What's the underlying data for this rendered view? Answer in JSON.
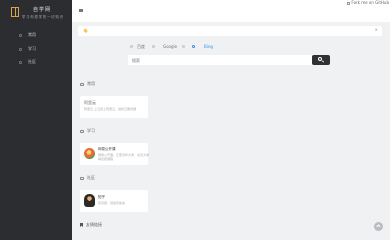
{
  "sidebar": {
    "logo_title": "自学网",
    "logo_subtitle": "学习你想学的一切知识",
    "nav": [
      {
        "label": "常用",
        "icon": "folder-icon"
      },
      {
        "label": "学习",
        "icon": "book-icon"
      },
      {
        "label": "社区",
        "icon": "users-icon"
      }
    ]
  },
  "topbar": {
    "github_label": "Fork me on GitHub"
  },
  "notice": {
    "text": "👋",
    "close_label": "×"
  },
  "search": {
    "engines": [
      {
        "label": "百度",
        "active": false
      },
      {
        "label": "Google",
        "active": false
      },
      {
        "label": "Bing",
        "active": true
      }
    ],
    "placeholder": "搜索"
  },
  "sections": [
    {
      "title": "常用",
      "card": {
        "logo_name": "aliyun-logo",
        "logo_text": "阿里云",
        "title": "",
        "desc": "阿里云-上云就上阿里云，提供云服务器"
      }
    },
    {
      "title": "学习",
      "card": {
        "logo_name": "fruit-logo",
        "title": "网易公开课",
        "desc": "网易公开课，汇聚清华大学、北京大学",
        "desc2": "等优质课程"
      }
    },
    {
      "title": "社区",
      "card": {
        "logo_name": "character-logo",
        "title": "知乎",
        "desc": "有问题，就会有答案"
      }
    }
  ],
  "footer_section": {
    "title": "友情链接"
  }
}
